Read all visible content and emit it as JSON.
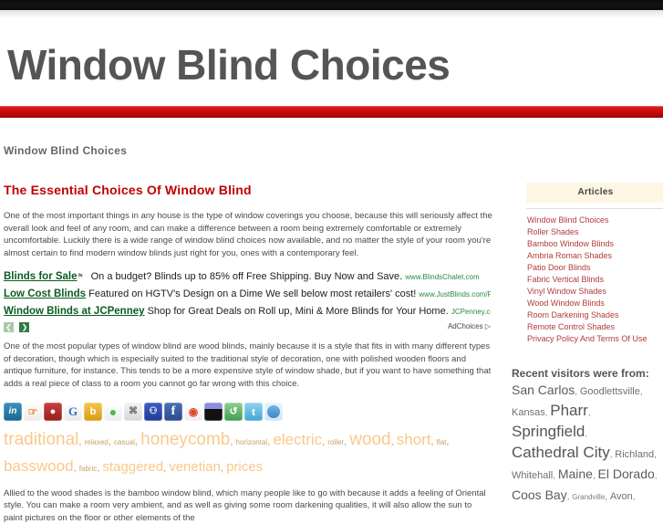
{
  "site": {
    "title": "Window Blind Choices",
    "breadcrumb": "Window Blind Choices",
    "accent_red": "#c00000",
    "band_red": "#c90d0d"
  },
  "article": {
    "title": "The Essential Choices Of Window Blind",
    "paragraph_1": "One of the most important things in any house is the type of window coverings you choose, because this will seriously affect the overall look and feel of any room, and can make a difference between a room being extremely comfortable or extremely uncomfortable. Luckily there is a wide range of window blind choices now available, and no matter the style of your room you're almost certain to find modern window blinds just right for you, ones with a contemporary feel.",
    "paragraph_2": "One of the most popular types of window blind are wood blinds, mainly because it is a style that fits in with many different types of decoration, though which is especially suited to the traditional style of decoration, one with polished wooden floors and antique furniture, for instance. This tends to be a more expensive style of window shade, but if you want to have something that adds a real piece of class to a room you cannot go far wrong with this choice.",
    "paragraph_3": "Allied to the wood shades is the bamboo window blind, which many people like to go with because it adds a feeling of Oriental style. You can make a room very ambient, and as well as giving some room darkening qualities, it will also allow the sun to paint pictures on the floor or other elements of the"
  },
  "ads": {
    "rows": [
      {
        "link": "Blinds for Sale",
        "flag": "⚑",
        "text": "On a budget? Blinds up to 85% off Free Shipping. Buy Now and Save.",
        "url": "www.BlindsChalet.com"
      },
      {
        "link": "Low Cost Blinds",
        "flag": "",
        "text": "Featured on HGTV's Design on a Dime We sell below most retailers' cost!",
        "url": "www.JustBlinds.com/Free_.."
      },
      {
        "link": "Window Blinds at JCPenney",
        "flag": "",
        "text": "Shop for Great Deals on Roll up, Mini & More Blinds for Your Home.",
        "url": "JCPenney.com/W.."
      }
    ],
    "prev_label": "❮",
    "next_label": "❯",
    "adchoices_label": "AdChoices ▷"
  },
  "social": {
    "icons": [
      {
        "name": "linkedin-icon",
        "glyph": "in",
        "cls": "sico-linkedin"
      },
      {
        "name": "squirrel-icon",
        "glyph": "☞",
        "cls": "sico-squirrel"
      },
      {
        "name": "delicious-icon",
        "glyph": "●",
        "cls": "sico-delicious"
      },
      {
        "name": "google-icon",
        "glyph": "G",
        "cls": "sico-google"
      },
      {
        "name": "bebo-icon",
        "glyph": "b",
        "cls": "sico-bebo"
      },
      {
        "name": "messenger-icon",
        "glyph": "●",
        "cls": "sico-msn"
      },
      {
        "name": "mixx-icon",
        "glyph": "⌘",
        "cls": "sico-mixx"
      },
      {
        "name": "myspace-icon",
        "glyph": "⚇",
        "cls": "sico-myspace"
      },
      {
        "name": "facebook-icon",
        "glyph": "f",
        "cls": "sico-facebook"
      },
      {
        "name": "reddit-icon",
        "glyph": "◉",
        "cls": "sico-reddit"
      },
      {
        "name": "digg-icon",
        "glyph": "",
        "cls": "sico-digg"
      },
      {
        "name": "stumbleupon-icon",
        "glyph": "↺",
        "cls": "sico-stumble"
      },
      {
        "name": "twitter-icon",
        "glyph": "t",
        "cls": "sico-twitter"
      },
      {
        "name": "share-icon",
        "glyph": "",
        "cls": "sico-share"
      }
    ]
  },
  "tagcloud": {
    "tags": [
      {
        "label": "traditional",
        "size": "tag-xl"
      },
      {
        "label": "relaxed",
        "size": "tag-sm"
      },
      {
        "label": "casual",
        "size": "tag-sm"
      },
      {
        "label": "honeycomb",
        "size": "tag-xl"
      },
      {
        "label": "horizontal",
        "size": "tag-sm"
      },
      {
        "label": "electric",
        "size": "tag-lg"
      },
      {
        "label": "roller",
        "size": "tag-sm"
      },
      {
        "label": "wood",
        "size": "tag-xl"
      },
      {
        "label": "short",
        "size": "tag-lg"
      },
      {
        "label": "flat",
        "size": "tag-sm"
      },
      {
        "label": "basswood",
        "size": "tag-lg"
      },
      {
        "label": "fabric",
        "size": "tag-sm"
      },
      {
        "label": "staggered",
        "size": "tag-md"
      },
      {
        "label": "venetian",
        "size": "tag-md"
      },
      {
        "label": "prices",
        "size": "tag-md"
      }
    ],
    "separator": ","
  },
  "sidebar": {
    "articles_heading": "Articles",
    "articles": [
      "Window Blind Choices",
      "Roller Shades",
      "Bamboo Window Blinds",
      "Ambria Roman Shades",
      "Patio Door Blinds",
      "Fabric Vertical Blinds",
      "Vinyl Window Shades",
      "Wood Window Blinds",
      "Room Darkening Shades",
      "Remote Control Shades",
      "Privacy Policy And Terms Of Use"
    ],
    "visitors_heading": "Recent visitors were from:",
    "visitors": [
      {
        "label": "San Carlos",
        "size": "city-lg"
      },
      {
        "label": "Goodlettsville",
        "size": "city-md"
      },
      {
        "label": "Kansas",
        "size": "city-md"
      },
      {
        "label": "Pharr",
        "size": "city-xl"
      },
      {
        "label": "Springfield",
        "size": "city-xl"
      },
      {
        "label": "Cathedral City",
        "size": "city-xl"
      },
      {
        "label": "Richland",
        "size": "city-md"
      },
      {
        "label": "Whitehall",
        "size": "city-md"
      },
      {
        "label": "Maine",
        "size": "city-lg"
      },
      {
        "label": "El Dorado",
        "size": "city-lg"
      },
      {
        "label": "Coos Bay",
        "size": "city-lg"
      },
      {
        "label": "Grandville",
        "size": "city-sm"
      },
      {
        "label": "Avon",
        "size": "city-md"
      }
    ],
    "separator": ","
  }
}
